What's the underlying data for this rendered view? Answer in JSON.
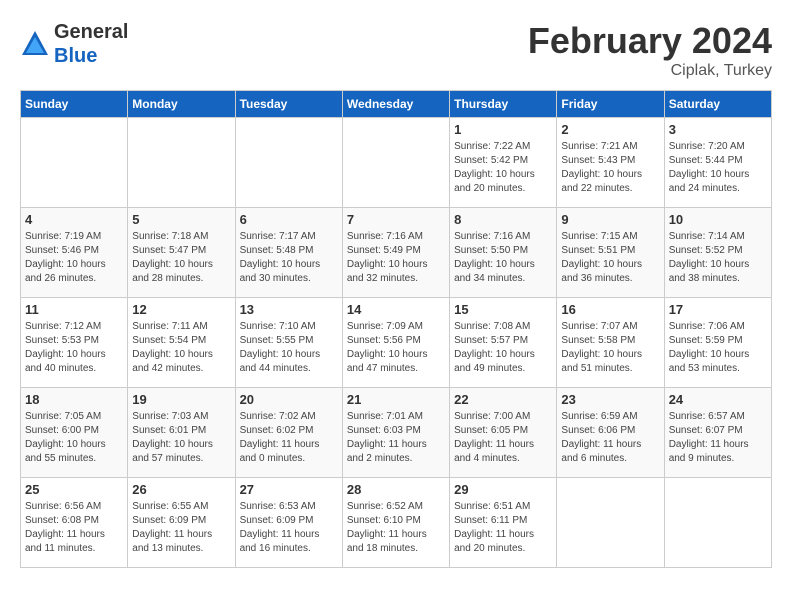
{
  "header": {
    "logo_general": "General",
    "logo_blue": "Blue",
    "month_title": "February 2024",
    "location": "Ciplak, Turkey"
  },
  "weekdays": [
    "Sunday",
    "Monday",
    "Tuesday",
    "Wednesday",
    "Thursday",
    "Friday",
    "Saturday"
  ],
  "weeks": [
    [
      {
        "day": "",
        "info": ""
      },
      {
        "day": "",
        "info": ""
      },
      {
        "day": "",
        "info": ""
      },
      {
        "day": "",
        "info": ""
      },
      {
        "day": "1",
        "info": "Sunrise: 7:22 AM\nSunset: 5:42 PM\nDaylight: 10 hours\nand 20 minutes."
      },
      {
        "day": "2",
        "info": "Sunrise: 7:21 AM\nSunset: 5:43 PM\nDaylight: 10 hours\nand 22 minutes."
      },
      {
        "day": "3",
        "info": "Sunrise: 7:20 AM\nSunset: 5:44 PM\nDaylight: 10 hours\nand 24 minutes."
      }
    ],
    [
      {
        "day": "4",
        "info": "Sunrise: 7:19 AM\nSunset: 5:46 PM\nDaylight: 10 hours\nand 26 minutes."
      },
      {
        "day": "5",
        "info": "Sunrise: 7:18 AM\nSunset: 5:47 PM\nDaylight: 10 hours\nand 28 minutes."
      },
      {
        "day": "6",
        "info": "Sunrise: 7:17 AM\nSunset: 5:48 PM\nDaylight: 10 hours\nand 30 minutes."
      },
      {
        "day": "7",
        "info": "Sunrise: 7:16 AM\nSunset: 5:49 PM\nDaylight: 10 hours\nand 32 minutes."
      },
      {
        "day": "8",
        "info": "Sunrise: 7:16 AM\nSunset: 5:50 PM\nDaylight: 10 hours\nand 34 minutes."
      },
      {
        "day": "9",
        "info": "Sunrise: 7:15 AM\nSunset: 5:51 PM\nDaylight: 10 hours\nand 36 minutes."
      },
      {
        "day": "10",
        "info": "Sunrise: 7:14 AM\nSunset: 5:52 PM\nDaylight: 10 hours\nand 38 minutes."
      }
    ],
    [
      {
        "day": "11",
        "info": "Sunrise: 7:12 AM\nSunset: 5:53 PM\nDaylight: 10 hours\nand 40 minutes."
      },
      {
        "day": "12",
        "info": "Sunrise: 7:11 AM\nSunset: 5:54 PM\nDaylight: 10 hours\nand 42 minutes."
      },
      {
        "day": "13",
        "info": "Sunrise: 7:10 AM\nSunset: 5:55 PM\nDaylight: 10 hours\nand 44 minutes."
      },
      {
        "day": "14",
        "info": "Sunrise: 7:09 AM\nSunset: 5:56 PM\nDaylight: 10 hours\nand 47 minutes."
      },
      {
        "day": "15",
        "info": "Sunrise: 7:08 AM\nSunset: 5:57 PM\nDaylight: 10 hours\nand 49 minutes."
      },
      {
        "day": "16",
        "info": "Sunrise: 7:07 AM\nSunset: 5:58 PM\nDaylight: 10 hours\nand 51 minutes."
      },
      {
        "day": "17",
        "info": "Sunrise: 7:06 AM\nSunset: 5:59 PM\nDaylight: 10 hours\nand 53 minutes."
      }
    ],
    [
      {
        "day": "18",
        "info": "Sunrise: 7:05 AM\nSunset: 6:00 PM\nDaylight: 10 hours\nand 55 minutes."
      },
      {
        "day": "19",
        "info": "Sunrise: 7:03 AM\nSunset: 6:01 PM\nDaylight: 10 hours\nand 57 minutes."
      },
      {
        "day": "20",
        "info": "Sunrise: 7:02 AM\nSunset: 6:02 PM\nDaylight: 11 hours\nand 0 minutes."
      },
      {
        "day": "21",
        "info": "Sunrise: 7:01 AM\nSunset: 6:03 PM\nDaylight: 11 hours\nand 2 minutes."
      },
      {
        "day": "22",
        "info": "Sunrise: 7:00 AM\nSunset: 6:05 PM\nDaylight: 11 hours\nand 4 minutes."
      },
      {
        "day": "23",
        "info": "Sunrise: 6:59 AM\nSunset: 6:06 PM\nDaylight: 11 hours\nand 6 minutes."
      },
      {
        "day": "24",
        "info": "Sunrise: 6:57 AM\nSunset: 6:07 PM\nDaylight: 11 hours\nand 9 minutes."
      }
    ],
    [
      {
        "day": "25",
        "info": "Sunrise: 6:56 AM\nSunset: 6:08 PM\nDaylight: 11 hours\nand 11 minutes."
      },
      {
        "day": "26",
        "info": "Sunrise: 6:55 AM\nSunset: 6:09 PM\nDaylight: 11 hours\nand 13 minutes."
      },
      {
        "day": "27",
        "info": "Sunrise: 6:53 AM\nSunset: 6:09 PM\nDaylight: 11 hours\nand 16 minutes."
      },
      {
        "day": "28",
        "info": "Sunrise: 6:52 AM\nSunset: 6:10 PM\nDaylight: 11 hours\nand 18 minutes."
      },
      {
        "day": "29",
        "info": "Sunrise: 6:51 AM\nSunset: 6:11 PM\nDaylight: 11 hours\nand 20 minutes."
      },
      {
        "day": "",
        "info": ""
      },
      {
        "day": "",
        "info": ""
      }
    ]
  ]
}
